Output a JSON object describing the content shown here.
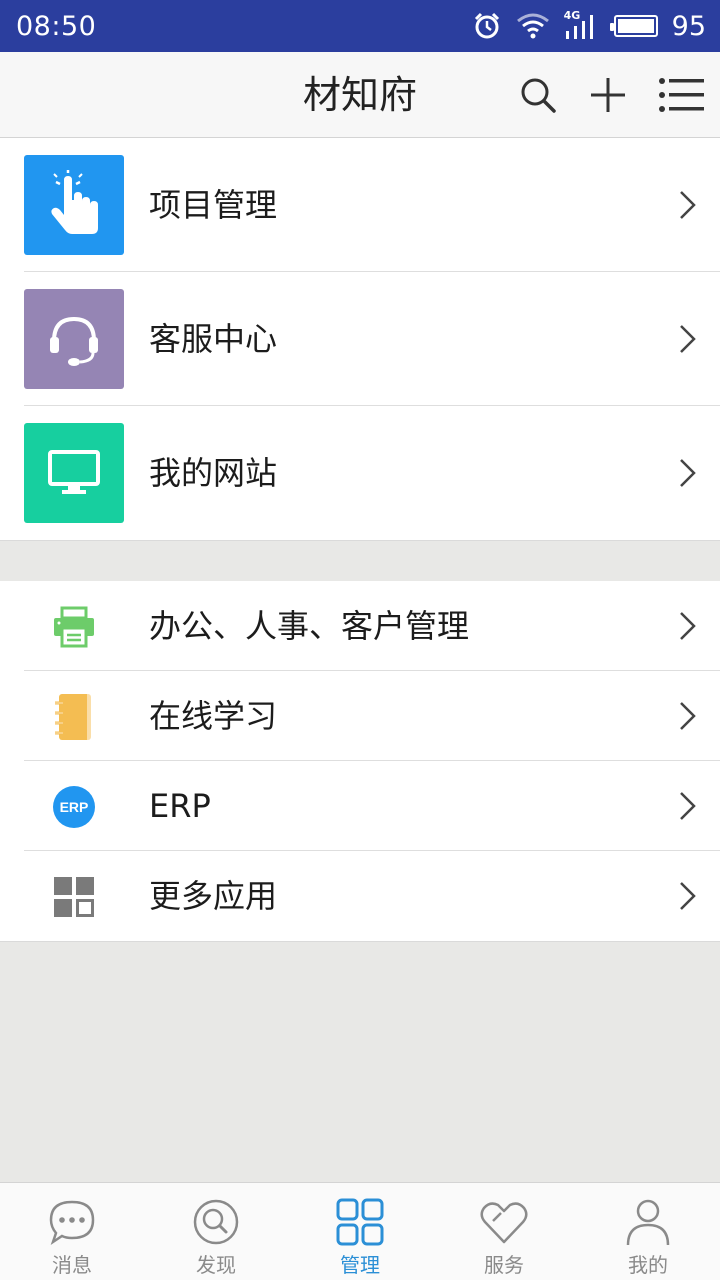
{
  "status_bar": {
    "time": "08:50",
    "network": "4G",
    "battery_level": "95"
  },
  "header": {
    "title": "材知府"
  },
  "primary_items": [
    {
      "label": "项目管理",
      "color": "#2196f0",
      "icon": "touch-hand-icon"
    },
    {
      "label": "客服中心",
      "color": "#9585b4",
      "icon": "headset-icon"
    },
    {
      "label": "我的网站",
      "color": "#17cf9f",
      "icon": "monitor-icon"
    }
  ],
  "secondary_items": [
    {
      "label": "办公、人事、客户管理",
      "color": "#6dcc6a",
      "icon": "printer-icon"
    },
    {
      "label": "在线学习",
      "color": "#f4bd52",
      "icon": "notebook-icon"
    },
    {
      "label": "ERP",
      "color": "#2196f0",
      "icon": "erp-badge-icon",
      "badge_text": "ERP"
    },
    {
      "label": "更多应用",
      "color": "#7a7a7a",
      "icon": "grid-apps-icon"
    }
  ],
  "tabs": [
    {
      "label": "消息",
      "icon": "chat-bubble-icon",
      "active": false
    },
    {
      "label": "发现",
      "icon": "discover-search-icon",
      "active": false
    },
    {
      "label": "管理",
      "icon": "manage-grid-icon",
      "active": true
    },
    {
      "label": "服务",
      "icon": "heart-icon",
      "active": false
    },
    {
      "label": "我的",
      "icon": "person-icon",
      "active": false
    }
  ],
  "accent_color": "#2b8fd6"
}
